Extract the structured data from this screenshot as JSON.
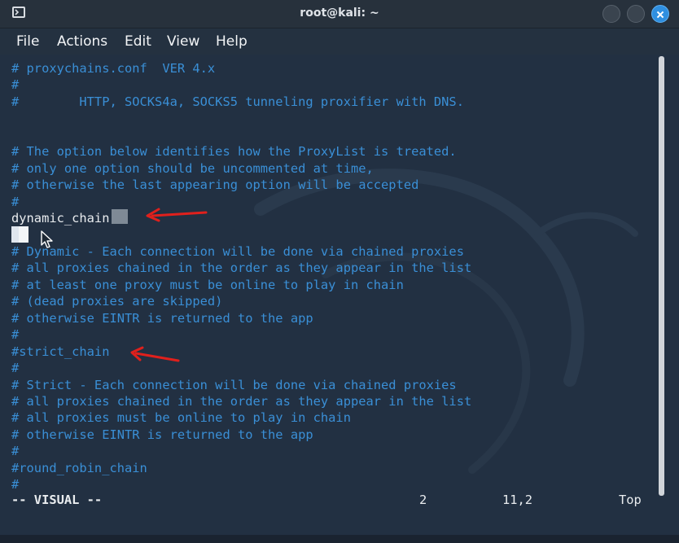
{
  "window": {
    "title": "root@kali: ~"
  },
  "menu": [
    "File",
    "Actions",
    "Edit",
    "View",
    "Help"
  ],
  "terminal": {
    "lines": [
      "# proxychains.conf  VER 4.x",
      "#",
      "#        HTTP, SOCKS4a, SOCKS5 tunneling proxifier with DNS.",
      "",
      "",
      "# The option below identifies how the ProxyList is treated.",
      "# only one option should be uncommented at time,",
      "# otherwise the last appearing option will be accepted",
      "#",
      "dynamic_chain",
      "",
      "# Dynamic - Each connection will be done via chained proxies",
      "# all proxies chained in the order as they appear in the list",
      "# at least one proxy must be online to play in chain",
      "# (dead proxies are skipped)",
      "# otherwise EINTR is returned to the app",
      "#",
      "#strict_chain",
      "#",
      "# Strict - Each connection will be done via chained proxies",
      "# all proxies chained in the order as they appear in the list",
      "# all proxies must be online to play in chain",
      "# otherwise EINTR is returned to the app",
      "#",
      "#round_robin_chain",
      "#"
    ],
    "status": {
      "mode": "-- VISUAL --",
      "selected": "2",
      "position": "11,2",
      "scroll": "Top"
    }
  },
  "icons": {
    "window_icon": "terminal-icon",
    "annotation": "red-arrow-icon",
    "pointer": "mouse-pointer-icon"
  },
  "colors": {
    "comment": "#3a8fd6",
    "text": "#e9ecef",
    "background": "#223042",
    "annotation": "#e0201c",
    "close_button": "#2f8fe0"
  }
}
